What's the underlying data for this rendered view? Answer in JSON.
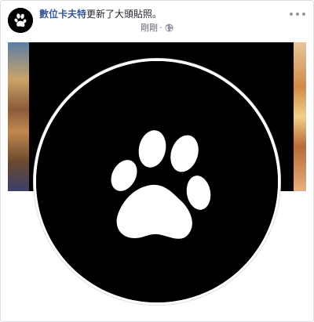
{
  "post": {
    "page_name": "數位卡夫特",
    "action_text": "更新了大頭貼照。",
    "timestamp": "剛剛",
    "separator": "·",
    "privacy_icon": "globe-icon",
    "more_icon": "more-options-icon"
  },
  "media": {
    "profile_picture_icon": "paw-icon",
    "avatar_icon": "paw-icon"
  },
  "colors": {
    "page_name": "#365899",
    "text": "#1d2129",
    "meta": "#616770",
    "profile_bg": "#000000",
    "border": "#dddfe2"
  }
}
